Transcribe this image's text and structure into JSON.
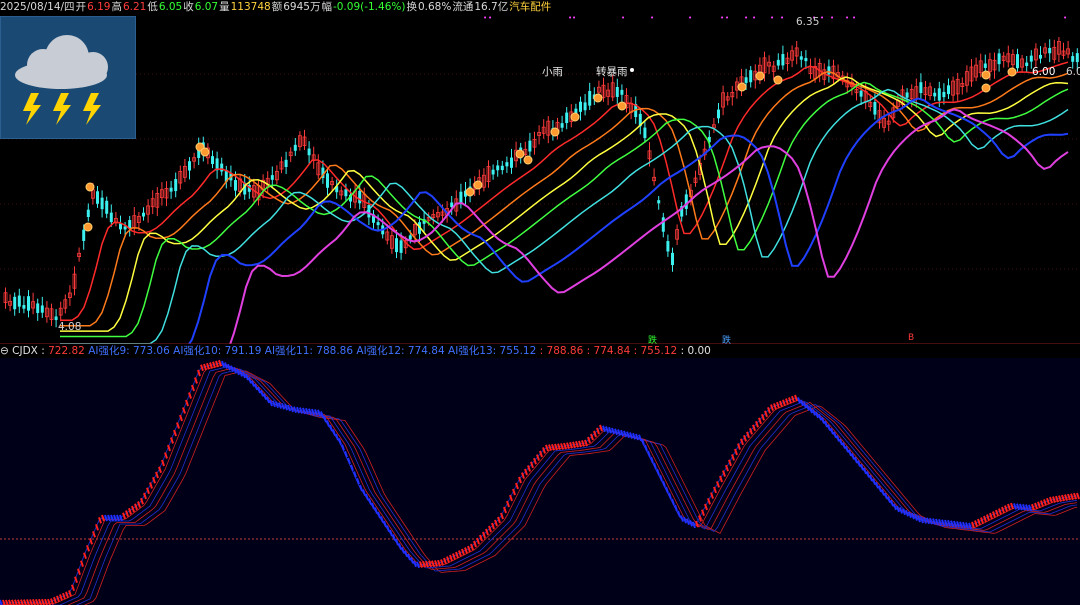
{
  "info": {
    "date": "2025/08/14/四",
    "open_label": "开",
    "open": "6.19",
    "high_label": "高",
    "high": "6.21",
    "low_label": "低",
    "low": "6.05",
    "close_label": "收",
    "close": "6.07",
    "volume_label": "量",
    "volume": "113748",
    "amount_label": "额",
    "amount": "6945万",
    "change_label": "幅",
    "change": "-0.09(-1.46%)",
    "turnover_label": "换",
    "turnover": "0.68%",
    "float_label": "流通",
    "float": "16.7亿",
    "sector": "汽车配件"
  },
  "weather": {
    "icon": "thunderstorm-icon"
  },
  "main_chart": {
    "high_mark": "6.35",
    "low_mark": "4.08",
    "right_price_a": "6.00",
    "right_price_b": "6.0",
    "annotation_light_rain": "小雨",
    "annotation_storm": "转暴雨",
    "signal_up": "跌",
    "signal_mid": "跌",
    "signal_right": "B"
  },
  "indicator": {
    "name": "CJDX",
    "v1": "722.82",
    "v2_label": "AI强化9",
    "v2": "773.06",
    "v3_label": "AI强化10",
    "v3": "791.19",
    "v4_label": "AI强化11",
    "v4": "788.86",
    "v5_label": "AI强化12",
    "v5": "774.84",
    "v6_label": "AI强化13",
    "v6": "755.12",
    "v7": "788.86",
    "v8": "774.84",
    "v9": "755.12",
    "v10": "0.00"
  },
  "colors": {
    "up": "#ff3b3b",
    "down": "#3df0f0",
    "ma_magenta": "#e040e0",
    "ma_blue": "#2040ff"
  }
}
